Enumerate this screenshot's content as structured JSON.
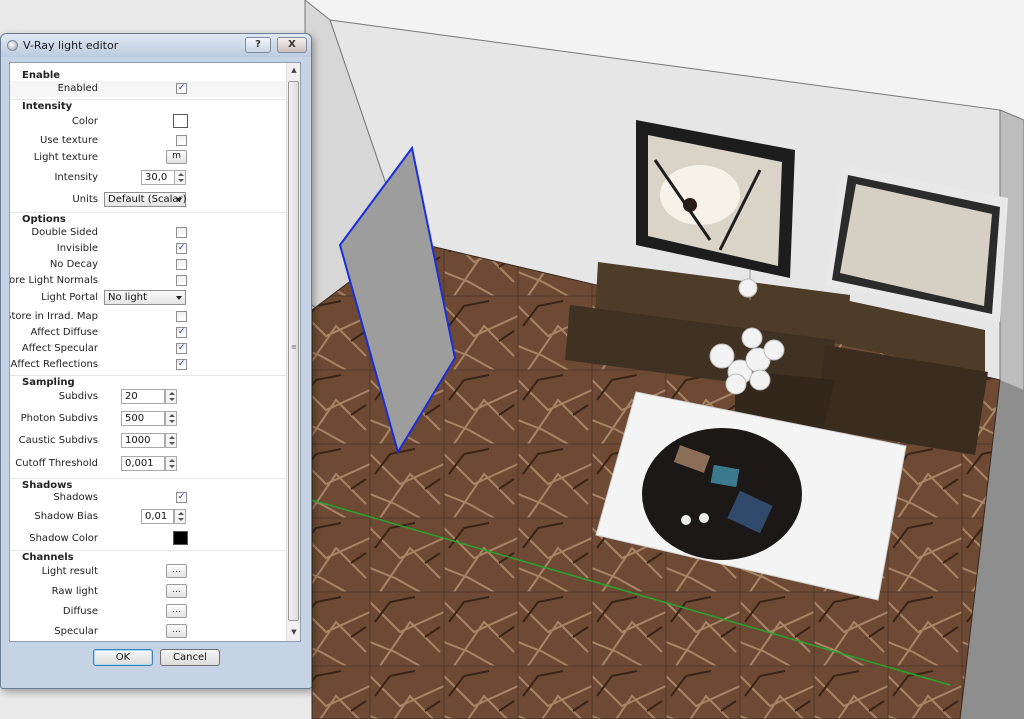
{
  "dialog": {
    "title": "V-Ray light editor",
    "help_label": "?",
    "close_label": "X",
    "ok_label": "OK",
    "cancel_label": "Cancel"
  },
  "sections": {
    "enable": "Enable",
    "intensity": "Intensity",
    "options": "Options",
    "sampling": "Sampling",
    "shadows": "Shadows",
    "channels": "Channels"
  },
  "enable": {
    "enabled": {
      "label": "Enabled",
      "checked": true
    }
  },
  "intensity": {
    "color_label": "Color",
    "color_value": "#ffffff",
    "use_texture": {
      "label": "Use texture",
      "checked": false
    },
    "light_texture_label": "Light texture",
    "light_texture_button": "m",
    "intensity_label": "Intensity",
    "intensity_value": "30,0",
    "units_label": "Units",
    "units_value": "Default (Scalar)"
  },
  "options": {
    "double_sided": {
      "label": "Double Sided",
      "checked": false
    },
    "invisible": {
      "label": "Invisible",
      "checked": true
    },
    "no_decay": {
      "label": "No Decay",
      "checked": false
    },
    "ignore_light_normals": {
      "label": "Ignore Light Normals",
      "checked": false
    },
    "light_portal_label": "Light Portal",
    "light_portal_value": "No light",
    "store_in_irrad_map": {
      "label": "Store in Irrad. Map",
      "checked": false
    },
    "affect_diffuse": {
      "label": "Affect Diffuse",
      "checked": true
    },
    "affect_specular": {
      "label": "Affect Specular",
      "checked": true
    },
    "affect_reflections": {
      "label": "Affect Reflections",
      "checked": true
    }
  },
  "sampling": {
    "subdivs_label": "Subdivs",
    "subdivs_value": "20",
    "photon_subdivs_label": "Photon Subdivs",
    "photon_subdivs_value": "500",
    "caustic_subdivs_label": "Caustic Subdivs",
    "caustic_subdivs_value": "1000",
    "cutoff_threshold_label": "Cutoff Threshold",
    "cutoff_threshold_value": "0,001"
  },
  "shadows": {
    "shadows": {
      "label": "Shadows",
      "checked": true
    },
    "shadow_bias_label": "Shadow Bias",
    "shadow_bias_value": "0,01",
    "shadow_color_label": "Shadow Color",
    "shadow_color_value": "#000000"
  },
  "channels": {
    "button_label": "...",
    "items": [
      "Light result",
      "Raw light",
      "Diffuse",
      "Specular"
    ]
  },
  "check_glyph": "✓",
  "colors": {
    "wall": "#e6e6e6",
    "floor": "#6e4a35",
    "sofa": "#3f3222",
    "rug": "#f4f4f4",
    "table": "#1b1817",
    "light_plane": "#9d9d9d",
    "light_outline": "#1a2fd8"
  }
}
